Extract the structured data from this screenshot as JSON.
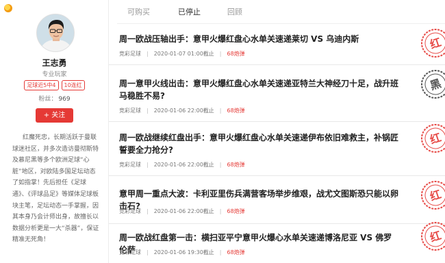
{
  "profile": {
    "name": "王志勇",
    "role": "专业玩家",
    "badges": [
      "足球近5中4",
      "10连红"
    ],
    "fans_label": "粉丝：",
    "fans_count": "969",
    "follow_label": "+ 关注",
    "bio": "红魔死忠，长期活跃于曼联球迷社区，并多次造访曼彻斯特及慕尼黑等多个欧洲足球“心脏”地区，对欧陆多国足坛动态了如指掌！先后担任《足球通》、《评球品足》等媒体足球板块主笔，足坛动态一手掌握，因其本身乃会计师出身，故擅长以数据分析更是一大“杀器”，保证精准无死角！"
  },
  "tabs": [
    "可购买",
    "已停止",
    "回顾"
  ],
  "active_tab": "已停止",
  "articles": [
    {
      "title": "周一欧战压轴出手：意甲火爆红盘心水单关速递莱切 VS 乌迪内斯",
      "category": "竞彩足球",
      "date": "2020-01-07 01:00截止",
      "reads": "68炮弹",
      "stamp": "红",
      "stamp_color": "#e53935"
    },
    {
      "title": "周一意甲火线出击：意甲火爆红盘心水单关速递亚特兰大神经刀十足，战升班马稳胜不易?",
      "category": "竞彩足球",
      "date": "2020-01-06 22:00截止",
      "reads": "68炮弹",
      "stamp": "黑",
      "stamp_color": "#444444"
    },
    {
      "title": "周一欧战继续红盘出手：意甲火爆红盘心水单关速递伊布依旧难救主，补锅匠誓要全力抢分?",
      "category": "竞彩足球",
      "date": "2020-01-06 22:00截止",
      "reads": "68炮弹",
      "stamp": "红",
      "stamp_color": "#e53935"
    },
    {
      "title": "意甲周一重点大波：卡利亚里伤兵满营客场举步维艰，战尤文图斯恐只能以卵击石?",
      "category": "竞彩足球",
      "date": "2020-01-06 22:00截止",
      "reads": "68炮弹",
      "stamp": "红",
      "stamp_color": "#e53935"
    },
    {
      "title": "周一欧战红盘第一击：横扫亚平宁意甲火爆心水单关速递博洛尼亚 VS 佛罗伦萨",
      "category": "竞彩足球",
      "date": "2020-01-06 19:30截止",
      "reads": "68炮弹",
      "stamp": "红",
      "stamp_color": "#e53935"
    }
  ]
}
